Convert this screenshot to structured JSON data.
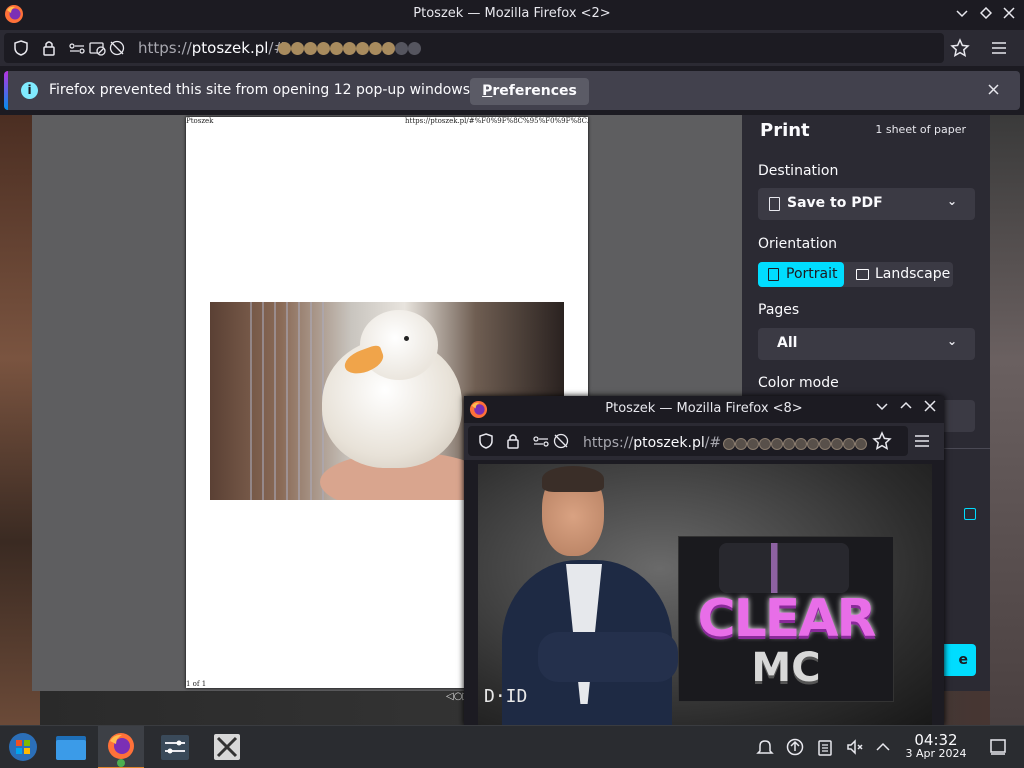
{
  "window": {
    "title": "Ptoszek — Mozilla Firefox <2>"
  },
  "urlbar": {
    "scheme": "https://",
    "host": "ptoszek.pl",
    "path": "/#"
  },
  "notification": {
    "message": "Firefox prevented this site from opening 12 pop-up windows.",
    "button_label_first": "P",
    "button_label_rest": "references"
  },
  "print_preview": {
    "header_left": "Ptoszek",
    "header_right": "https://ptoszek.pl/#%F0%9F%8C%95%F0%9F%8C...",
    "footer_left": "1 of 1"
  },
  "print_panel": {
    "title": "Print",
    "sheets": "1 sheet of paper",
    "destination_label": "Destination",
    "destination_value": "Save to PDF",
    "orientation_label": "Orientation",
    "portrait": "Portrait",
    "landscape": "Landscape",
    "pages_label": "Pages",
    "pages_value": "All",
    "color_mode_label": "Color mode",
    "save_partial": "e"
  },
  "popup": {
    "title": "Ptoszek — Mozilla Firefox <8>",
    "scheme": "https://",
    "host": "ptoszek.pl",
    "path": "/#",
    "video_logo_line1": "CLEAR",
    "video_logo_line2": "MC",
    "video_watermark": "D·ID"
  },
  "taskbar": {
    "time": "04:32",
    "date": "3 Apr 2024"
  },
  "colors": {
    "accent": "#00ddff",
    "taskbar_active": "#e0862d"
  }
}
